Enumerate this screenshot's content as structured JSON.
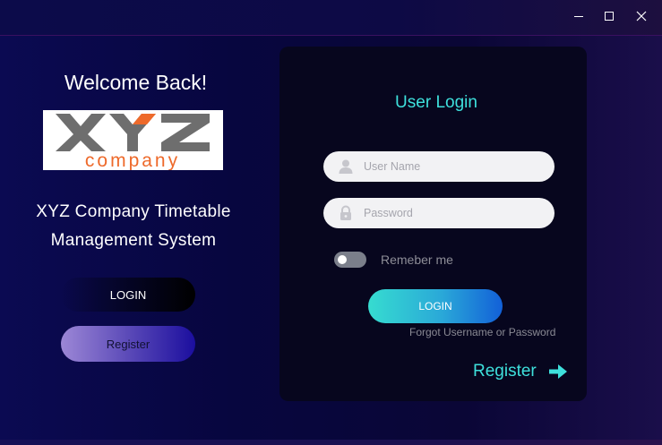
{
  "window": {
    "controls": {
      "minimize_icon": "minimize-icon",
      "maximize_icon": "maximize-icon",
      "close_icon": "close-icon"
    }
  },
  "left": {
    "welcome": "Welcome Back!",
    "logo": {
      "line1": "XYZ",
      "line2": "company",
      "colors": {
        "gray": "#6e6e6e",
        "orange": "#ee6a2b"
      }
    },
    "system_title_line1": "XYZ Company Timetable",
    "system_title_line2": "Management System",
    "login_label": "LOGIN",
    "register_label": "Register"
  },
  "card": {
    "title": "User Login",
    "username": {
      "placeholder": "User Name",
      "value": "",
      "icon": "user-icon"
    },
    "password": {
      "placeholder": "Password",
      "value": "",
      "icon": "lock-icon"
    },
    "remember": {
      "label": "Remeber me",
      "checked": false
    },
    "login_label": "LOGIN",
    "forgot_label": "Forgot Username or Password",
    "register_label": "Register",
    "register_icon": "arrow-right-icon"
  },
  "colors": {
    "accent": "#3ee0dc",
    "card_bg": "#07061e",
    "page_bg": "#07063f"
  }
}
